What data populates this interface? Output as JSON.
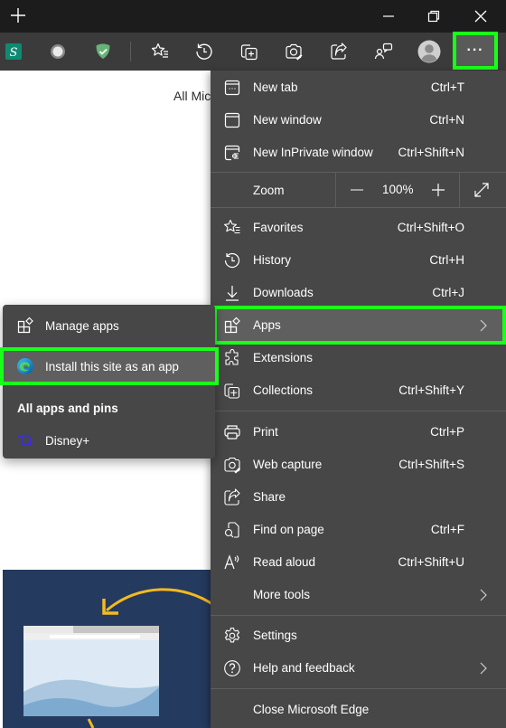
{
  "titlebar": {
    "new_tab_icon": "plus-icon",
    "minimize_icon": "minimize-icon",
    "restore_icon": "restore-icon",
    "close_icon": "close-icon"
  },
  "toolbar": {
    "extensions": [
      {
        "name": "stylus-extension-icon"
      },
      {
        "name": "record-extension-icon"
      },
      {
        "name": "adguard-shield-icon"
      }
    ],
    "buttons": [
      {
        "name": "favorites-icon"
      },
      {
        "name": "history-icon"
      },
      {
        "name": "collections-icon"
      },
      {
        "name": "web-capture-icon"
      },
      {
        "name": "share-icon"
      },
      {
        "name": "feedback-icon"
      },
      {
        "name": "profile-avatar"
      }
    ],
    "more_label": "···"
  },
  "page": {
    "heading_partial": "All Mic"
  },
  "menu": {
    "items": [
      {
        "label": "New tab",
        "shortcut": "Ctrl+T",
        "icon": "new-tab-icon"
      },
      {
        "label": "New window",
        "shortcut": "Ctrl+N",
        "icon": "new-window-icon"
      },
      {
        "label": "New InPrivate window",
        "shortcut": "Ctrl+Shift+N",
        "icon": "inprivate-icon"
      }
    ],
    "zoom": {
      "label": "Zoom",
      "value": "100%",
      "minus": "—",
      "plus": "+"
    },
    "items2": [
      {
        "label": "Favorites",
        "shortcut": "Ctrl+Shift+O",
        "icon": "favorites-icon"
      },
      {
        "label": "History",
        "shortcut": "Ctrl+H",
        "icon": "history-icon"
      },
      {
        "label": "Downloads",
        "shortcut": "Ctrl+J",
        "icon": "download-icon"
      },
      {
        "label": "Apps",
        "shortcut": "",
        "icon": "apps-icon",
        "submenu": true
      },
      {
        "label": "Extensions",
        "shortcut": "",
        "icon": "extensions-icon"
      },
      {
        "label": "Collections",
        "shortcut": "Ctrl+Shift+Y",
        "icon": "collections-icon"
      }
    ],
    "items3": [
      {
        "label": "Print",
        "shortcut": "Ctrl+P",
        "icon": "print-icon"
      },
      {
        "label": "Web capture",
        "shortcut": "Ctrl+Shift+S",
        "icon": "web-capture-icon"
      },
      {
        "label": "Share",
        "shortcut": "",
        "icon": "share-icon"
      },
      {
        "label": "Find on page",
        "shortcut": "Ctrl+F",
        "icon": "find-icon"
      },
      {
        "label": "Read aloud",
        "shortcut": "Ctrl+Shift+U",
        "icon": "read-aloud-icon"
      },
      {
        "label": "More tools",
        "shortcut": "",
        "icon": "",
        "submenu": true
      }
    ],
    "items4": [
      {
        "label": "Settings",
        "icon": "gear-icon"
      },
      {
        "label": "Help and feedback",
        "icon": "help-icon",
        "submenu": true
      }
    ],
    "close_label": "Close Microsoft Edge"
  },
  "apps_submenu": {
    "manage_label": "Manage apps",
    "install_label": "Install this site as an app",
    "section_heading": "All apps and pins",
    "apps": [
      {
        "label": "Disney+",
        "icon": "disney-plus-icon"
      }
    ]
  },
  "colors": {
    "highlight": "#1aff1a",
    "menu_bg": "#474747",
    "hover_bg": "#5f5f5f",
    "titlebar_bg": "#1c1c1c",
    "toolbar_bg": "#3b3b3b",
    "banner_bg": "#243a5e",
    "banner_accent": "#f5b921"
  }
}
